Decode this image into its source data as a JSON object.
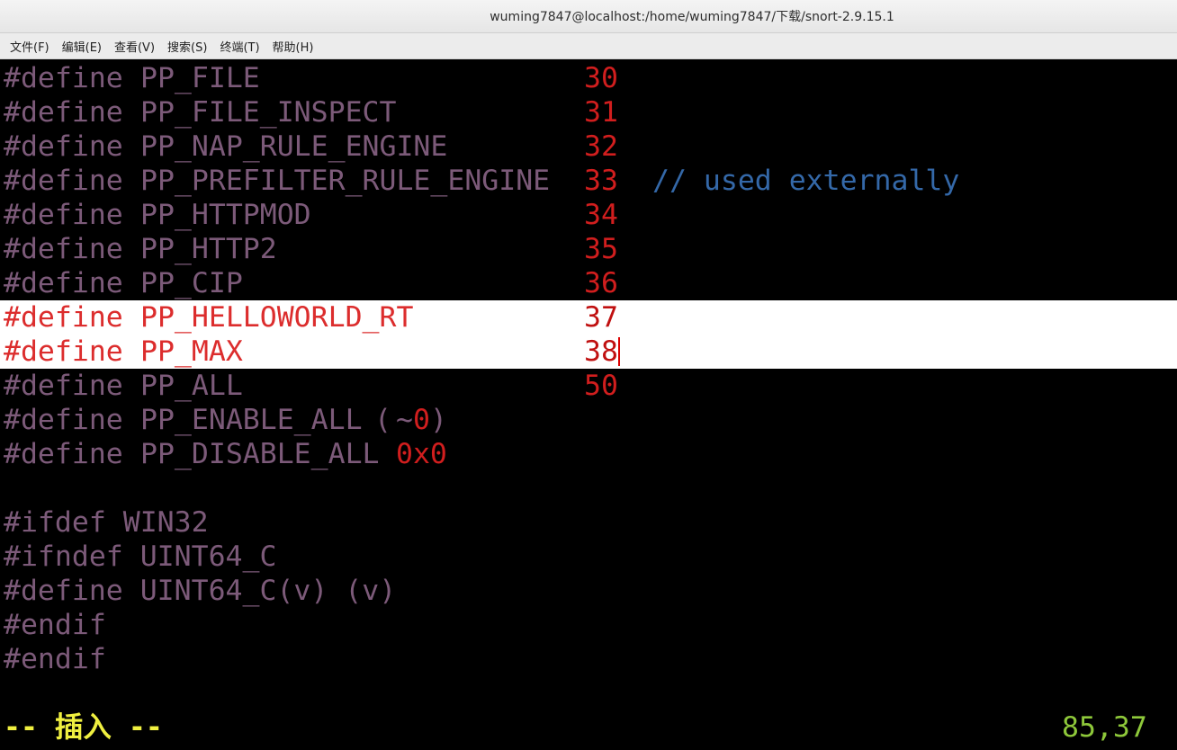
{
  "window": {
    "title": "wuming7847@localhost:/home/wuming7847/下载/snort-2.9.15.1"
  },
  "menubar": {
    "items": [
      "文件(F)",
      "编辑(E)",
      "查看(V)",
      "搜索(S)",
      "终端(T)",
      "帮助(H)"
    ]
  },
  "editor": {
    "lines": [
      {
        "directive": "#define",
        "name": "PP_FILE",
        "value": "30",
        "comment": ""
      },
      {
        "directive": "#define",
        "name": "PP_FILE_INSPECT",
        "value": "31",
        "comment": ""
      },
      {
        "directive": "#define",
        "name": "PP_NAP_RULE_ENGINE",
        "value": "32",
        "comment": ""
      },
      {
        "directive": "#define",
        "name": "PP_PREFILTER_RULE_ENGINE",
        "value": "33",
        "comment": "// used externally"
      },
      {
        "directive": "#define",
        "name": "PP_HTTPMOD",
        "value": "34",
        "comment": ""
      },
      {
        "directive": "#define",
        "name": "PP_HTTP2",
        "value": "35",
        "comment": ""
      },
      {
        "directive": "#define",
        "name": "PP_CIP",
        "value": "36",
        "comment": ""
      },
      {
        "directive": "#define",
        "name": "PP_HELLOWORLD_RT",
        "value": "37",
        "comment": "",
        "highlighted": true
      },
      {
        "directive": "#define",
        "name": "PP_MAX",
        "value": "38",
        "comment": "",
        "highlighted": true,
        "cursor": true
      },
      {
        "directive": "#define",
        "name": "PP_ALL",
        "value": "50",
        "comment": ""
      }
    ],
    "enable_all": {
      "directive": "#define",
      "name": "PP_ENABLE_ALL",
      "open_paren": "(",
      "tilde": "~",
      "zero": "0",
      "close_paren": ")"
    },
    "disable_all": {
      "directive": "#define",
      "name": "PP_DISABLE_ALL",
      "value": "0x0"
    },
    "ifdef_line": "#ifdef WIN32",
    "ifndef_line": "#ifndef UINT64_C",
    "uint64_define": "#define UINT64_C(v) (v)",
    "endif_1": "#endif",
    "endif_2": "#endif"
  },
  "statusbar": {
    "mode": "-- 插入 --",
    "position": "85,37"
  },
  "colors": {
    "preproc": "#7c5a79",
    "number": "#d11e1e",
    "comment": "#3468a8",
    "mode": "#f0f040",
    "position": "#8ec83a"
  }
}
